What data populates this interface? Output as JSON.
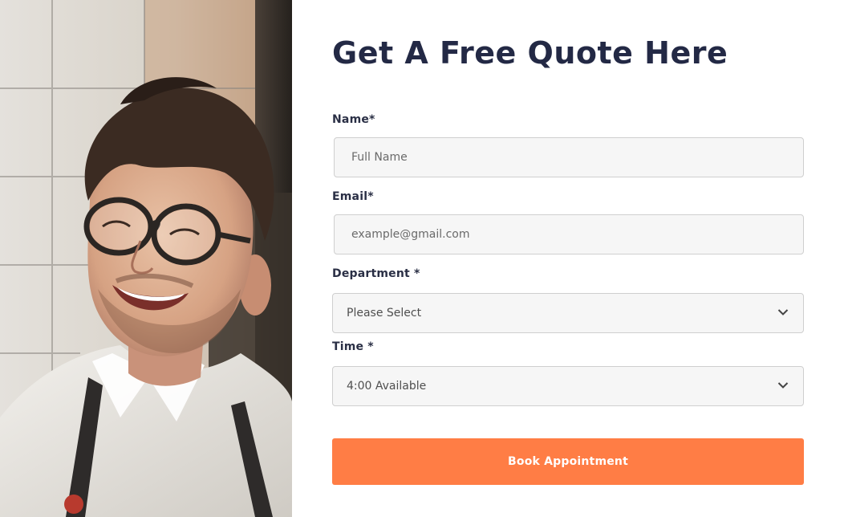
{
  "hero_image": {
    "icon": "smiling-man-with-glasses-photo"
  },
  "form": {
    "title": "Get A Free Quote Here",
    "name": {
      "label": "Name*",
      "placeholder": "Full Name",
      "value": ""
    },
    "email": {
      "label": "Email*",
      "placeholder": "example@gmail.com",
      "value": ""
    },
    "department": {
      "label": "Department *",
      "selected": "Please Select",
      "icon": "chevron-down-icon"
    },
    "time": {
      "label": "Time *",
      "selected": "4:00 Available",
      "icon": "chevron-down-icon"
    },
    "submit_label": "Book Appointment"
  },
  "colors": {
    "accent": "#ff7d45",
    "heading": "#232945",
    "field_bg": "#f6f6f6",
    "field_border": "#cfcfcf"
  }
}
